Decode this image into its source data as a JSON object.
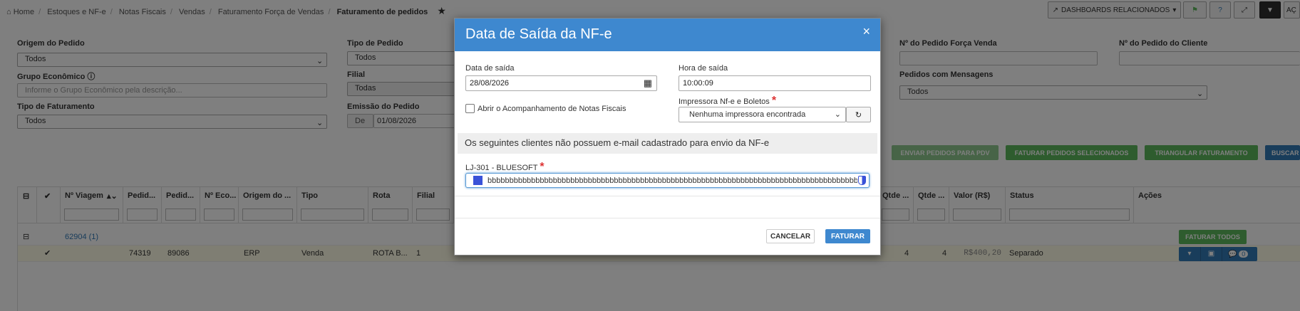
{
  "breadcrumb": [
    "Home",
    "Estoques e NF-e",
    "Notas Fiscais",
    "Vendas",
    "Faturamento Força de Vendas",
    "Faturamento de pedidos"
  ],
  "topbar": {
    "dashboards_label": "DASHBOARDS RELACIONADOS",
    "acoes_label": "AÇ"
  },
  "filters": {
    "origem_label": "Origem do Pedido",
    "origem_value": "Todos",
    "grupo_label": "Grupo Econômico",
    "grupo_placeholder": "Informe o Grupo Econômico pela descrição...",
    "tipofat_label": "Tipo de Faturamento",
    "tipofat_value": "Todos",
    "tipo_label": "Tipo de Pedido",
    "tipo_value": "Todos",
    "filial_label": "Filial",
    "filial_value": "Todas",
    "emissao_label": "Emissão do Pedido",
    "emissao_de": "De",
    "emissao_value": "01/08/2026",
    "forca_label": "Nº do Pedido Força Venda",
    "cliente_label": "Nº do Pedido do Cliente",
    "mensagens_label": "Pedidos com Mensagens",
    "mensagens_value": "Todos"
  },
  "actions": {
    "enviar_pdv": "ENVIAR PEDIDOS PARA PDV",
    "faturar_sel": "FATURAR PEDIDOS SELECIONADOS",
    "triangular": "TRIANGULAR FATURAMENTO",
    "buscar": "BUSCAR"
  },
  "grid": {
    "headers": [
      "Nº Viagem",
      "Pedid...",
      "Pedid...",
      "Nº Eco...",
      "Origem do ...",
      "Tipo",
      "Rota",
      "Filial",
      "Qtde ...",
      "Qtde ...",
      "Valor (R$)",
      "Status",
      "Ações"
    ],
    "group_row": {
      "label": "62904 (1)",
      "faturar_todos": "FATURAR TODOS"
    },
    "row": {
      "pedido1": "74319",
      "pedido2": "89086",
      "origem": "ERP",
      "tipo": "Venda",
      "rota": "ROTA B...",
      "filial": "1",
      "qtde1": "4",
      "qtde2": "4",
      "valor": "R$400,20",
      "status": "Separado",
      "badge": "0"
    }
  },
  "modal": {
    "title": "Data de Saída da NF-e",
    "data_label": "Data de saída",
    "data_value": "28/08/2026",
    "hora_label": "Hora de saída",
    "hora_value": "10:00:09",
    "abrir_label": "Abrir o Acompanhamento de Notas Fiscais",
    "impressora_label": "Impressora Nf-e e Boletos",
    "impressora_value": "Nenhuma impressora encontrada",
    "warning": "Os seguintes clientes não possuem e-mail cadastrado para envio da NF-e",
    "cliente_label": "LJ-301 - BLUESOFT",
    "email_value": "bbbbbbbbbbbbbbbbbbbbbbbbbbbbbbbbbbbbbbbbbbbbbbbbbbbbbbbbbbbbbbbbbbbbbbbbbbbbbbbbbbbbbbb",
    "cancelar": "CANCELAR",
    "faturar": "FATURAR"
  },
  "colors": {
    "primary": "#3e88cf",
    "success": "#5cb85c",
    "accent": "#337ab7"
  }
}
